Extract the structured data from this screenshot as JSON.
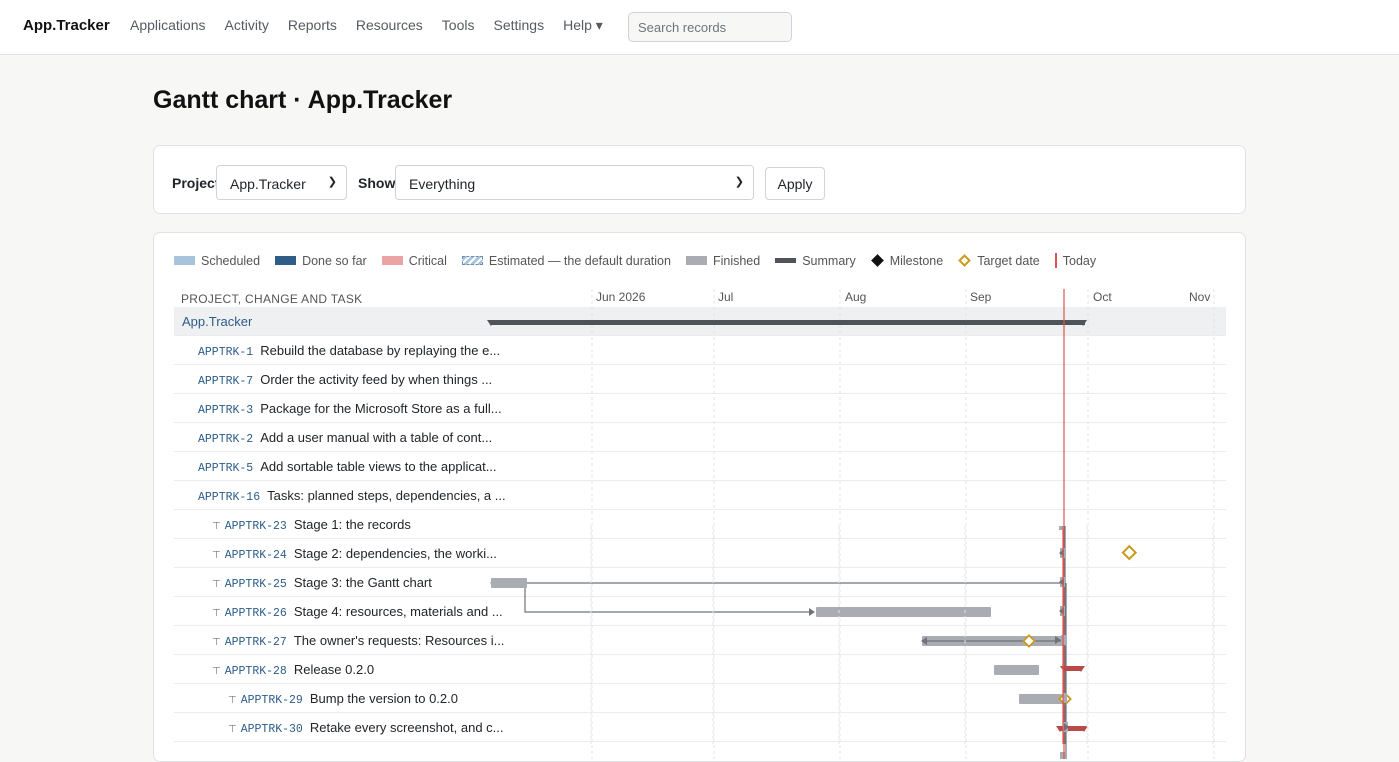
{
  "app": {
    "brand": "App.Tracker",
    "nav": [
      "Applications",
      "Activity",
      "Reports",
      "Resources",
      "Tools",
      "Settings",
      "Help ▾"
    ],
    "search_placeholder": "Search records"
  },
  "page": {
    "title": "Gantt chart · App.Tracker"
  },
  "filter": {
    "project_label": "Project",
    "project_value": "App.Tracker",
    "show_label": "Show",
    "show_value": "Everything",
    "apply_label": "Apply"
  },
  "legend": [
    {
      "label": "Scheduled",
      "kind": "solid",
      "color": "#a8c4dd"
    },
    {
      "label": "Done so far",
      "kind": "solid",
      "color": "#2f5d87"
    },
    {
      "label": "Critical",
      "kind": "solid",
      "color": "#eca3a3"
    },
    {
      "label": "Estimated — the default duration",
      "kind": "dashed",
      "color": "#a8c4dd"
    },
    {
      "label": "Finished",
      "kind": "solid",
      "color": "#a9adb3"
    },
    {
      "label": "Summary",
      "kind": "summary",
      "color": "#505458"
    },
    {
      "label": "Milestone",
      "kind": "milestone",
      "color": "#111111"
    },
    {
      "label": "Target date",
      "kind": "target",
      "color": "#c99a1b"
    },
    {
      "label": "Today",
      "kind": "today",
      "color": "#d9534f"
    }
  ],
  "gantt": {
    "column_header": "PROJECT, CHANGE AND TASK",
    "months": [
      "Jun 2026",
      "Jul",
      "Aug",
      "Sep",
      "Oct",
      "Nov"
    ],
    "root": "App.Tracker",
    "rows": [
      {
        "key": "APPTRK-1",
        "text": "Rebuild the database by replaying the e...",
        "level": 0
      },
      {
        "key": "APPTRK-7",
        "text": "Order the activity feed by when things ...",
        "level": 0
      },
      {
        "key": "APPTRK-3",
        "text": "Package for the Microsoft Store as a full...",
        "level": 0
      },
      {
        "key": "APPTRK-2",
        "text": "Add a user manual with a table of cont...",
        "level": 0
      },
      {
        "key": "APPTRK-5",
        "text": "Add sortable table views to the applicat...",
        "level": 0
      },
      {
        "key": "APPTRK-16",
        "text": "Tasks: planned steps, dependencies, a ...",
        "level": 0
      },
      {
        "key": "APPTRK-23",
        "text": "Stage 1: the records",
        "level": 1
      },
      {
        "key": "APPTRK-24",
        "text": "Stage 2: dependencies, the worki...",
        "level": 1
      },
      {
        "key": "APPTRK-25",
        "text": "Stage 3: the Gantt chart",
        "level": 1
      },
      {
        "key": "APPTRK-26",
        "text": "Stage 4: resources, materials and ...",
        "level": 1
      },
      {
        "key": "APPTRK-27",
        "text": "The owner's requests: Resources i...",
        "level": 1
      },
      {
        "key": "APPTRK-28",
        "text": "Release 0.2.0",
        "level": 1
      },
      {
        "key": "APPTRK-29",
        "text": "Bump the version to 0.2.0",
        "level": 2
      },
      {
        "key": "APPTRK-30",
        "text": "Retake every screenshot, and c...",
        "level": 2
      }
    ]
  }
}
